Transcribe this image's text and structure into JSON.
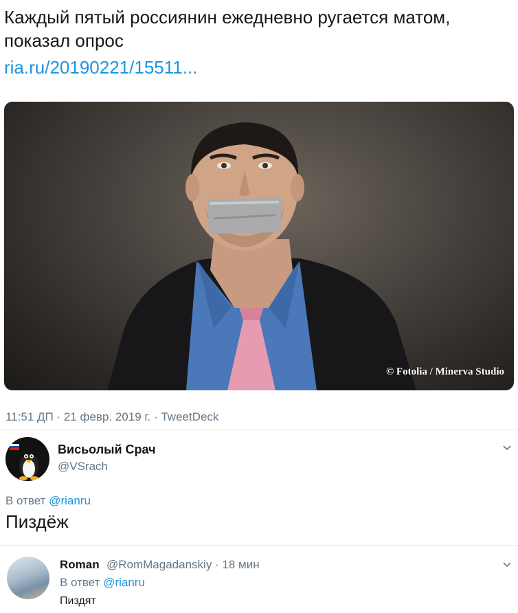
{
  "tweet": {
    "text": "Каждый пятый россиянин ежедневно ругается матом, показал опрос",
    "link": "ria.ru/20190221/15511...",
    "photo_credit": "© Fotolia / Minerva Studio",
    "meta": "11:51 ДП · 21 февр. 2019 г. · TweetDeck"
  },
  "replies": [
    {
      "name": "Висьолый Срач",
      "handle": "@VSrach",
      "reply_to_prefix": "В ответ",
      "reply_to_mention": "@rianru",
      "text": "Пиздёж",
      "menu_icon": "chevron-down-icon"
    },
    {
      "name": "Roman",
      "handle_time": "@RomMagadanskiy · 18 мин",
      "reply_to_prefix": "В ответ",
      "reply_to_mention": "@rianru",
      "text": "Пиздят",
      "menu_icon": "chevron-down-icon"
    }
  ],
  "colors": {
    "link": "#1b95e0",
    "secondary_text": "#657786",
    "primary_text": "#14171a"
  }
}
